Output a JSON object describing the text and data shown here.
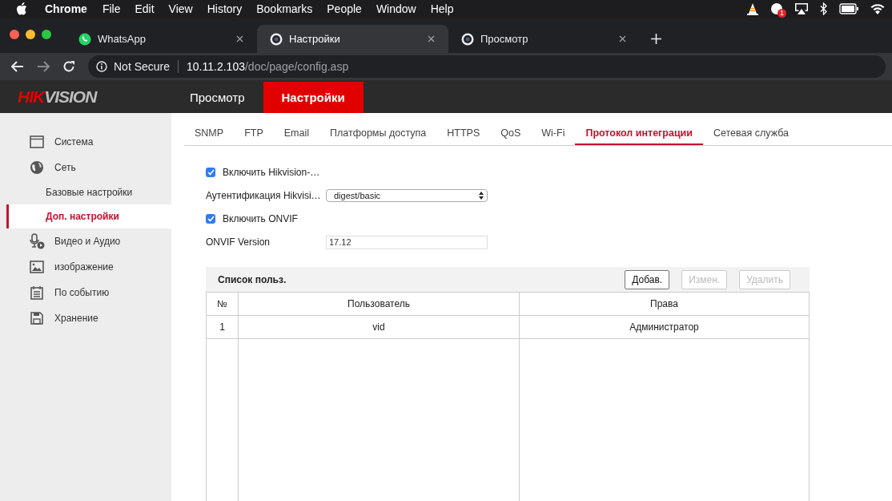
{
  "menubar": {
    "app": "Chrome",
    "items": [
      "File",
      "Edit",
      "View",
      "History",
      "Bookmarks",
      "People",
      "Window",
      "Help"
    ],
    "badge": "1"
  },
  "browser_tabs": [
    {
      "title": "WhatsApp",
      "kind": "whatsapp",
      "selected": false
    },
    {
      "title": "Настройки",
      "kind": "camera",
      "selected": true
    },
    {
      "title": "Просмотр",
      "kind": "camera",
      "selected": false
    }
  ],
  "address_bar": {
    "security": "Not Secure",
    "host": "10.11.2.103",
    "path": "/doc/page/config.asp"
  },
  "app_header": {
    "logo": [
      "HIK",
      "VISION"
    ],
    "nav": [
      {
        "label": "Просмотр",
        "selected": false
      },
      {
        "label": "Настройки",
        "selected": true
      }
    ]
  },
  "sidebar": [
    {
      "label": "Система",
      "kind": "section",
      "selected": false
    },
    {
      "label": "Сеть",
      "kind": "section",
      "selected": false
    },
    {
      "label": "Базовые настройки",
      "kind": "sub",
      "selected": false
    },
    {
      "label": "Доп. настройки",
      "kind": "sub",
      "selected": true
    },
    {
      "label": "Видео и Аудио",
      "kind": "section",
      "selected": false
    },
    {
      "label": "изображение",
      "kind": "section",
      "selected": false
    },
    {
      "label": "По событию",
      "kind": "section",
      "selected": false
    },
    {
      "label": "Хранение",
      "kind": "section",
      "selected": false
    }
  ],
  "tabs": [
    {
      "label": "SNMP",
      "selected": false
    },
    {
      "label": "FTP",
      "selected": false
    },
    {
      "label": "Email",
      "selected": false
    },
    {
      "label": "Платформы доступа",
      "selected": false
    },
    {
      "label": "HTTPS",
      "selected": false
    },
    {
      "label": "QoS",
      "selected": false
    },
    {
      "label": "Wi-Fi",
      "selected": false
    },
    {
      "label": "Протокол интеграции",
      "selected": true
    },
    {
      "label": "Сетевая служба",
      "selected": false
    }
  ],
  "form": [
    {
      "kind": "checkbox",
      "label": "Включить Hikvision-…",
      "checked": true
    },
    {
      "kind": "select",
      "label": "Аутентификация Hikvisi…",
      "value": "digest/basic"
    },
    {
      "kind": "checkbox",
      "label": "Включить ONVIF",
      "checked": true
    },
    {
      "kind": "text",
      "label": "ONVIF Version",
      "value": "17.12"
    }
  ],
  "user_list": {
    "title": "Список польз.",
    "buttons": [
      {
        "label": "Добав.",
        "disabled": false
      },
      {
        "label": "Измен.",
        "disabled": true
      },
      {
        "label": "Удалить",
        "disabled": true
      }
    ],
    "columns": [
      "№",
      "Пользователь",
      "Права"
    ],
    "rows": [
      [
        "1",
        "vid",
        "Администратор"
      ]
    ]
  }
}
